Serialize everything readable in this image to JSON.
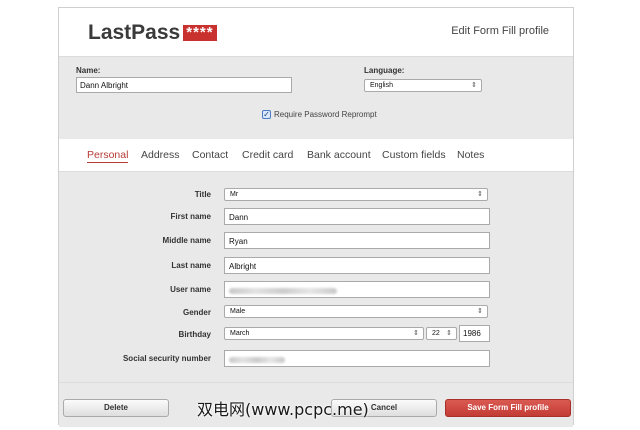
{
  "header": {
    "logo_text": "LastPass",
    "logo_stars": "****",
    "title": "Edit Form Fill profile"
  },
  "profile": {
    "name_label": "Name:",
    "name_value": "Dann Albright",
    "language_label": "Language:",
    "language_value": "English",
    "reprompt_label": "Require Password Reprompt",
    "reprompt_checked": true
  },
  "tabs": [
    {
      "label": "Personal",
      "active": true
    },
    {
      "label": "Address"
    },
    {
      "label": "Contact"
    },
    {
      "label": "Credit card"
    },
    {
      "label": "Bank account"
    },
    {
      "label": "Custom fields"
    },
    {
      "label": "Notes"
    }
  ],
  "form": {
    "title_label": "Title",
    "title_value": "Mr",
    "first_label": "First name",
    "first_value": "Dann",
    "middle_label": "Middle name",
    "middle_value": "Ryan",
    "last_label": "Last name",
    "last_value": "Albright",
    "username_label": "User name",
    "gender_label": "Gender",
    "gender_value": "Male",
    "birthday_label": "Birthday",
    "birth_month": "March",
    "birth_day": "22",
    "birth_year": "1986",
    "ssn_label": "Social security number"
  },
  "footer": {
    "delete_label": "Delete",
    "cancel_label": "Cancel",
    "save_label": "Save Form Fill profile"
  },
  "watermark": "双电网(www.pcpc.me)",
  "colors": {
    "accent": "#c23c35",
    "panel": "#e9e9e9",
    "logo_box": "#c8312d"
  }
}
